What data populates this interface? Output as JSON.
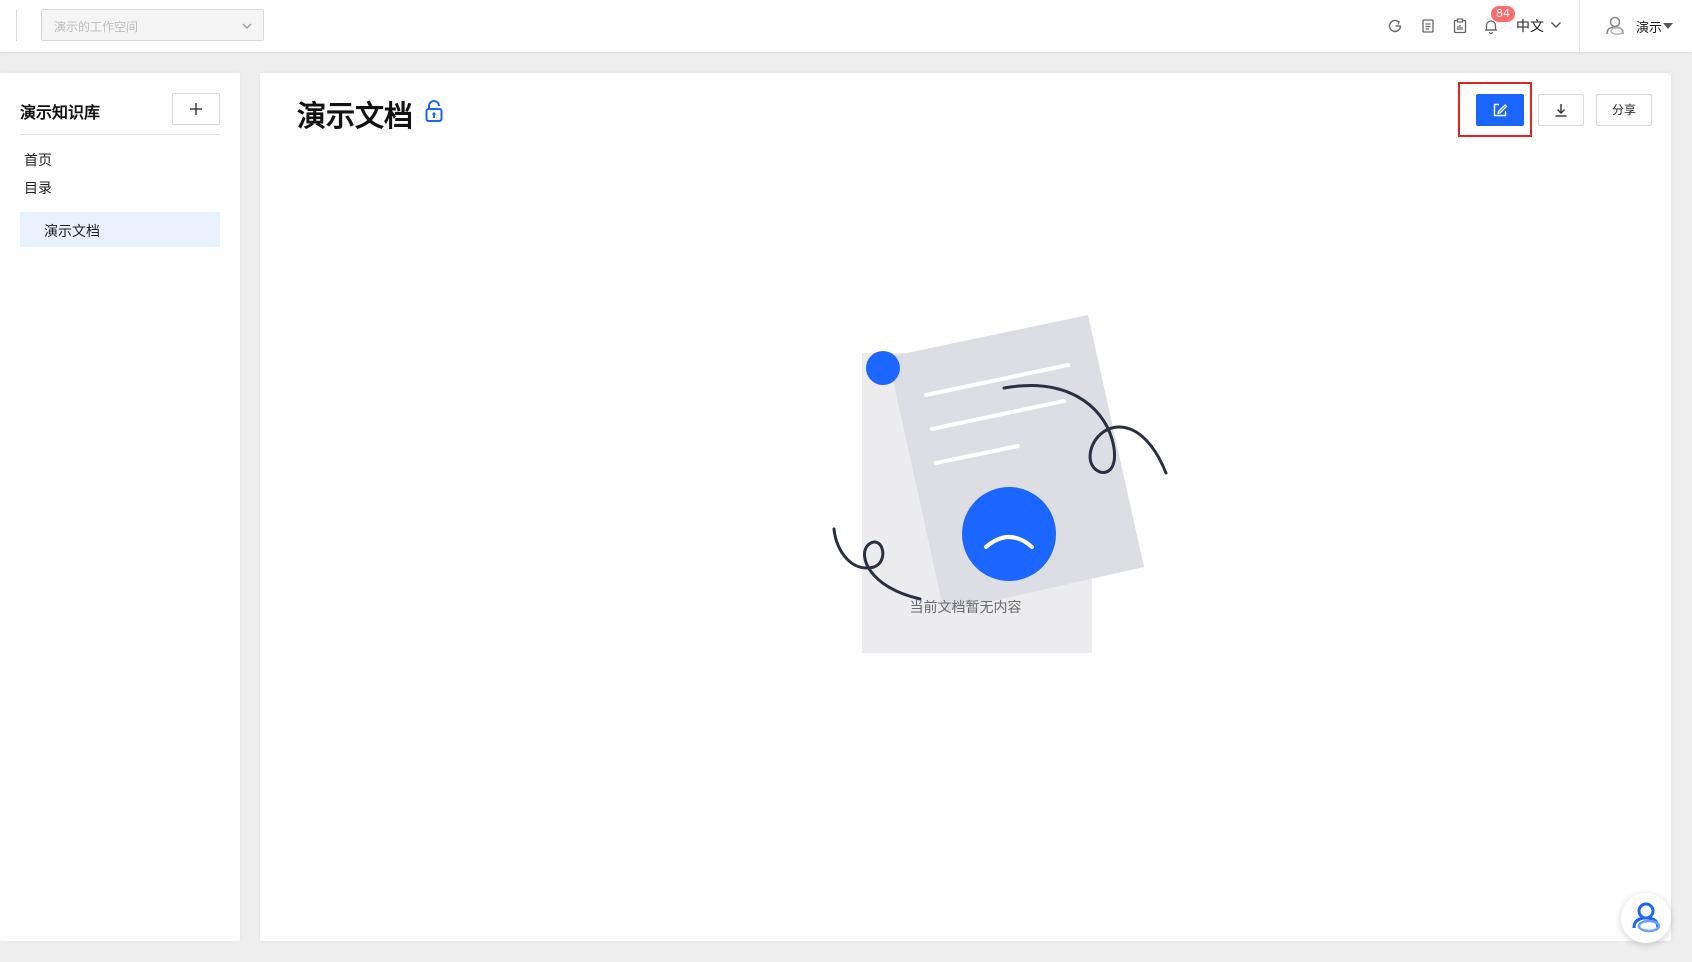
{
  "header": {
    "workspace_placeholder": "演示的工作空间",
    "notification_count": "84",
    "language": "中文",
    "user_name": "演示"
  },
  "sidebar": {
    "kb_title": "演示知识库",
    "nav": [
      "首页",
      "目录"
    ],
    "active_doc": "演示文档"
  },
  "main": {
    "doc_title": "演示文档",
    "share_label": "分享",
    "empty_text": "当前文档暂无内容"
  },
  "colors": {
    "primary": "#1a66ff",
    "badge": "#ff6b6b",
    "highlight_border": "#e02424"
  },
  "icons": {
    "header": [
      "refresh-icon",
      "document-icon",
      "clipboard-icon",
      "bell-icon",
      "chevron-down-icon",
      "user-avatar-icon"
    ],
    "sidebar": [
      "plus-icon"
    ],
    "main": [
      "lock-icon",
      "edit-icon",
      "download-icon",
      "empty-document-illustration",
      "assistant-icon"
    ]
  }
}
